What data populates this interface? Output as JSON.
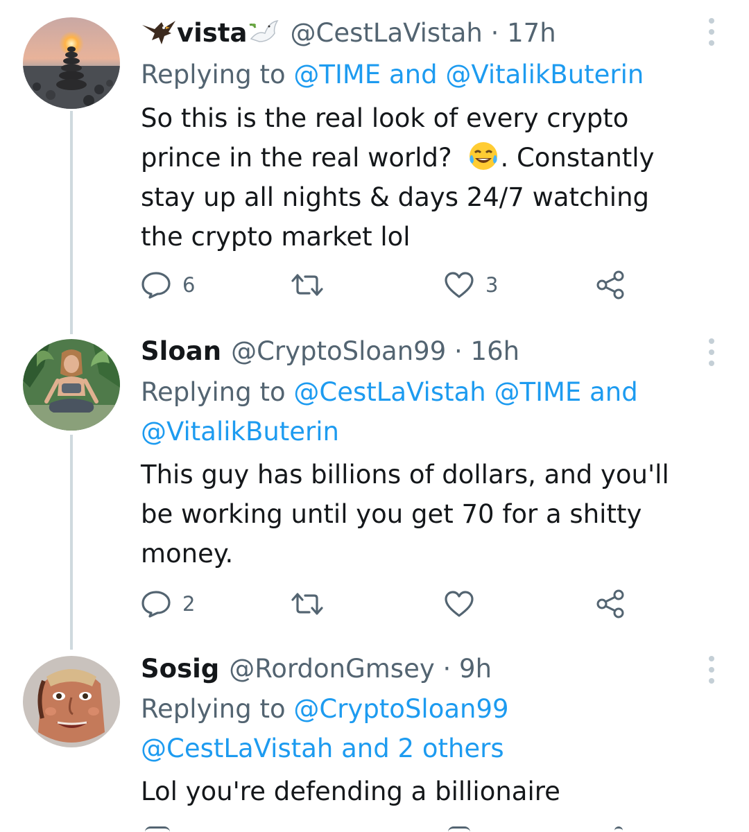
{
  "tweets": [
    {
      "display_name": "vista",
      "handle": "@CestLaVistah",
      "time": "17h",
      "reply_prefix": "Replying to",
      "reply_mentions_1": "@TIME",
      "reply_and": "and",
      "reply_mentions_2": "@VitalikButerin",
      "text_line1": "So this is the real look of every crypto",
      "text_line2a": "prince in the real world?",
      "text_line2b": ".   Constantly",
      "text_line3": "stay up all nights & days 24/7 watching",
      "text_line4": "the crypto market lol",
      "reply_count": "6",
      "retweet_count": "",
      "like_count": "3"
    },
    {
      "display_name": "Sloan",
      "handle": "@CryptoSloan99",
      "time": "16h",
      "reply_prefix": "Replying to",
      "reply_mentions_1": "@CestLaVistah @TIME",
      "reply_and": "and",
      "reply_mentions_2": "@VitalikButerin",
      "text_line1": "This guy has billions of dollars, and you'll",
      "text_line2": "be working until you get 70 for a shitty",
      "text_line3": "money.",
      "reply_count": "2",
      "retweet_count": "",
      "like_count": ""
    },
    {
      "display_name": "Sosig",
      "handle": "@RordonGmsey",
      "time": "9h",
      "reply_prefix": "Replying to",
      "reply_mentions_1": "@CryptoSloan99",
      "reply_mentions_2": "@CestLaVistah",
      "reply_and": "and",
      "reply_mentions_3": "2 others",
      "text_line1": "Lol you're defending a billionaire"
    }
  ],
  "separator": "·",
  "icons": {
    "reply": "reply-icon",
    "retweet": "retweet-icon",
    "like": "heart-icon",
    "share": "share-icon",
    "more": "more-vertical-icon",
    "eagle": "eagle-emoji-icon",
    "dove": "dove-emoji-icon",
    "laugh": "tears-of-joy-emoji-icon"
  },
  "colors": {
    "link": "#1d9bf0",
    "secondary_text": "#536471",
    "primary_text": "#14171a",
    "thread_line": "#cfd9de"
  }
}
